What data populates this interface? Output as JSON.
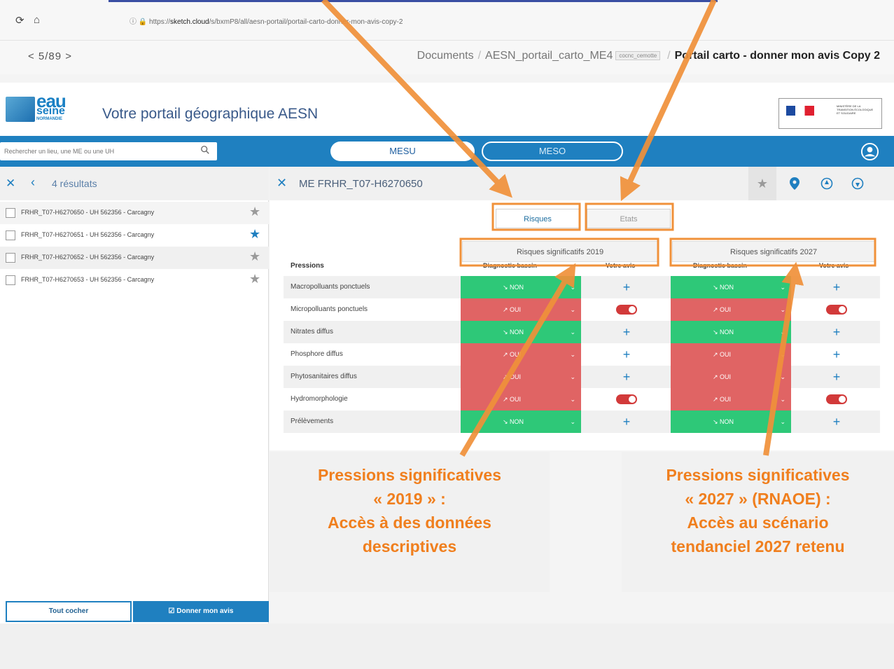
{
  "browser": {
    "url_prefix": "https://",
    "url_host": "sketch.cloud",
    "url_path": "/s/bxmP8/all/aesn-portail/portail-carto-donner-mon-avis-copy-2"
  },
  "cloud_header": {
    "pager": "< 5/89 >",
    "breadcrumb_documents": "Documents",
    "breadcrumb_file": "AESN_portail_carto_ME4",
    "breadcrumb_tag": "cocnc_cemotte",
    "breadcrumb_current": "Portail carto - donner mon avis Copy 2"
  },
  "app": {
    "logo_line1": "eau",
    "logo_line2": "seine",
    "logo_line3": "NORMANDIE",
    "title": "Votre portail géographique AESN",
    "gov_text": "MINISTÈRE DE LA TRANSITION ÉCOLOGIQUE ET SOLIDAIRE",
    "search_placeholder": "Rechercher un lieu, une ME ou une UH",
    "mesu": "MESU",
    "meso": "MESO"
  },
  "left_panel": {
    "result_count": "4 résultats",
    "results": [
      {
        "label": "FRHR_T07-H6270650 - UH 562356 - Carcagny",
        "starred": false
      },
      {
        "label": "FRHR_T07-H6270651 - UH 562356 - Carcagny",
        "starred": true
      },
      {
        "label": "FRHR_T07-H6270652 - UH 562356 - Carcagny",
        "starred": false
      },
      {
        "label": "FRHR_T07-H6270653 - UH 562356 - Carcagny",
        "starred": false
      }
    ],
    "select_all": "Tout cocher",
    "give_opinion": "Donner mon avis"
  },
  "right_panel": {
    "title": "ME FRHR_T07-H6270650",
    "tab_risques": "Risques",
    "tab_etats": "Etats",
    "group_2019": "Risques significatifs 2019",
    "group_2027": "Risques significatifs 2027",
    "col_pressions": "Pressions",
    "col_diagnostic": "Diagnostic bassin",
    "col_avis": "Votre avis",
    "rows": [
      {
        "name": "Macropolluants ponctuels",
        "v2019": "NON",
        "v2027": "NON",
        "avis2019": "plus",
        "avis2027": "plus"
      },
      {
        "name": "Micropolluants ponctuels",
        "v2019": "OUI",
        "v2027": "OUI",
        "avis2019": "toggle",
        "avis2027": "toggle"
      },
      {
        "name": "Nitrates diffus",
        "v2019": "NON",
        "v2027": "NON",
        "avis2019": "plus",
        "avis2027": "plus"
      },
      {
        "name": "Phosphore diffus",
        "v2019": "OUI",
        "v2027": "OUI",
        "avis2019": "plus",
        "avis2027": "plus"
      },
      {
        "name": "Phytosanitaires diffus",
        "v2019": "OUI",
        "v2027": "OUI",
        "avis2019": "plus",
        "avis2027": "plus"
      },
      {
        "name": "Hydromorphologie",
        "v2019": "OUI",
        "v2027": "OUI",
        "avis2019": "toggle",
        "avis2027": "toggle"
      },
      {
        "name": "Prélèvements",
        "v2019": "NON",
        "v2027": "NON",
        "avis2019": "plus",
        "avis2027": "plus"
      }
    ]
  },
  "callouts": {
    "left": [
      "Pressions significatives",
      "« 2019 » :",
      "Accès à des données",
      "descriptives"
    ],
    "right": [
      "Pressions significatives",
      "« 2027 » (RNAOE) :",
      "Accès au scénario",
      "tendanciel 2027 retenu"
    ]
  },
  "colors": {
    "brand_blue": "#1f80c0",
    "non_green": "#2ec878",
    "oui_red": "#e06464",
    "callout_orange": "#f07f1e"
  }
}
